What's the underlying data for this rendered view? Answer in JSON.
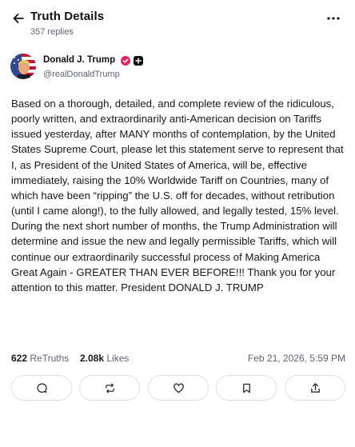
{
  "header": {
    "title": "Truth Details",
    "replies": "357 replies",
    "back_icon": "arrow-left-icon",
    "more_icon": "more-horizontal-icon"
  },
  "author": {
    "name": "Donald J. Trump",
    "handle": "@realDonaldTrump",
    "verified_color": "#e0245e"
  },
  "post": {
    "text": "Based on a thorough, detailed, and complete review of the ridiculous, poorly written, and extraordinarily anti-American decision on Tariffs issued yesterday, after MANY months of contemplation, by the United States Supreme Court, please let this statement serve to represent that I, as President of the United States of America, will be, effective immediately, raising the 10% Worldwide Tariff on Countries, many of which have been “ripping” the U.S. off for decades, without retribution (until I came along!), to the fully allowed, and legally tested, 15% level. During the next short number of months, the Trump Administration will determine and issue the new and legally permissible Tariffs, which will continue our extraordinarily successful process of Making America Great Again - GREATER THAN EVER BEFORE!!! Thank you for your attention to this matter. President DONALD J. TRUMP"
  },
  "stats": {
    "retruths_count": "622",
    "retruths_label": "ReTruths",
    "likes_count": "2.08k",
    "likes_label": "Likes",
    "timestamp": "Feb 21, 2026, 5:59 PM"
  },
  "actions": [
    {
      "name": "reply",
      "icon": "comment-icon"
    },
    {
      "name": "retruth",
      "icon": "repost-icon"
    },
    {
      "name": "like",
      "icon": "heart-icon"
    },
    {
      "name": "bookmark",
      "icon": "bookmark-icon"
    },
    {
      "name": "share",
      "icon": "share-icon"
    }
  ]
}
